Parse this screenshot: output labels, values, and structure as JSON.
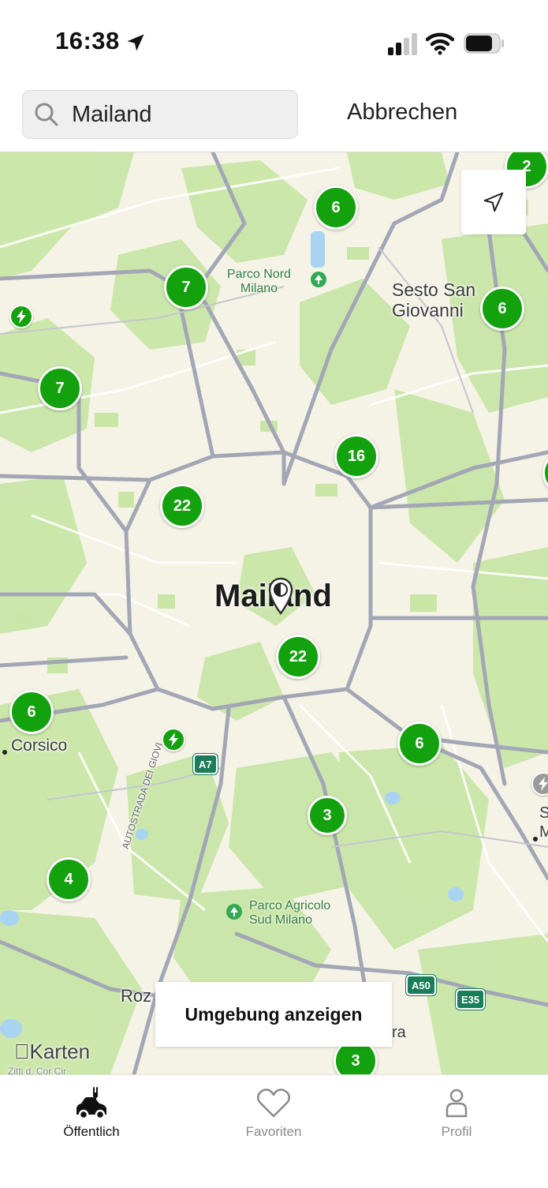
{
  "status_bar": {
    "time": "16:38"
  },
  "search": {
    "value": "Mailand",
    "cancel_label": "Abbrechen"
  },
  "map": {
    "city_label": "Mailand",
    "labels": {
      "sesto_line1": "Sesto San",
      "sesto_line2": "Giovanni",
      "corsico": "Corsico",
      "rozzano": "Roz",
      "ra": "ra",
      "autostrada": "AUTOSTRADA DEI GIOVI",
      "s_label": "S",
      "m_label": "M",
      "zitt": "Zitti d. Cor Cir"
    },
    "parks": {
      "nord_line1": "Parco Nord",
      "nord_line2": "Milano",
      "agricolo_line1": "Parco Agricolo",
      "agricolo_line2": "Sud Milano"
    },
    "road_shields": {
      "a7": "A7",
      "a50": "A50",
      "e35": "E35"
    },
    "clusters": [
      "6",
      "7",
      "6",
      "7",
      "16",
      "22",
      "22",
      "6",
      "6",
      "3",
      "4",
      "3",
      "2"
    ],
    "show_area_button": "Umgebung anzeigen",
    "attribution": "Karten"
  },
  "tabs": [
    {
      "label": "Öffentlich",
      "icon": "ev-car-icon",
      "active": true
    },
    {
      "label": "Favoriten",
      "icon": "heart-icon",
      "active": false
    },
    {
      "label": "Profil",
      "icon": "person-icon",
      "active": false
    }
  ],
  "colors": {
    "accent": "#13a10e",
    "map_bg": "#f5f2e6",
    "park": "#c9e6a7",
    "road": "#a3a7b5"
  }
}
